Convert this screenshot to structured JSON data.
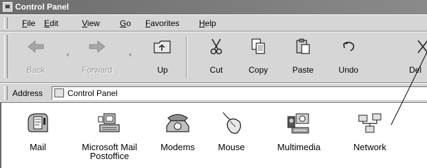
{
  "window": {
    "title": "Control Panel"
  },
  "menu": [
    "File",
    "Edit",
    "View",
    "Go",
    "Favorites",
    "Help"
  ],
  "toolbar": {
    "buttons": [
      {
        "label": "Back",
        "icon": "back-arrow-icon",
        "enabled": false
      },
      {
        "label": "Forward",
        "icon": "forward-arrow-icon",
        "enabled": false
      },
      {
        "label": "Up",
        "icon": "up-folder-icon",
        "enabled": true
      },
      {
        "label": "Cut",
        "icon": "scissors-icon",
        "enabled": true
      },
      {
        "label": "Copy",
        "icon": "copy-icon",
        "enabled": true
      },
      {
        "label": "Paste",
        "icon": "paste-icon",
        "enabled": true
      },
      {
        "label": "Undo",
        "icon": "undo-icon",
        "enabled": true
      },
      {
        "label": "Del",
        "icon": "delete-icon",
        "enabled": true
      }
    ]
  },
  "address": {
    "label": "Address",
    "value": "Control Panel"
  },
  "items": [
    {
      "name": "Mail",
      "icon": "mail-icon"
    },
    {
      "name": "Microsoft Mail Postoffice",
      "icon": "mail-postoffice-icon"
    },
    {
      "name": "Modems",
      "icon": "telephone-icon"
    },
    {
      "name": "Mouse",
      "icon": "mouse-icon"
    },
    {
      "name": "Multimedia",
      "icon": "multimedia-icon"
    },
    {
      "name": "Network",
      "icon": "network-icon"
    }
  ],
  "colors": {
    "titlebar": "#7a7a7a",
    "chrome": "#d6d6d6",
    "content": "#ffffff"
  }
}
